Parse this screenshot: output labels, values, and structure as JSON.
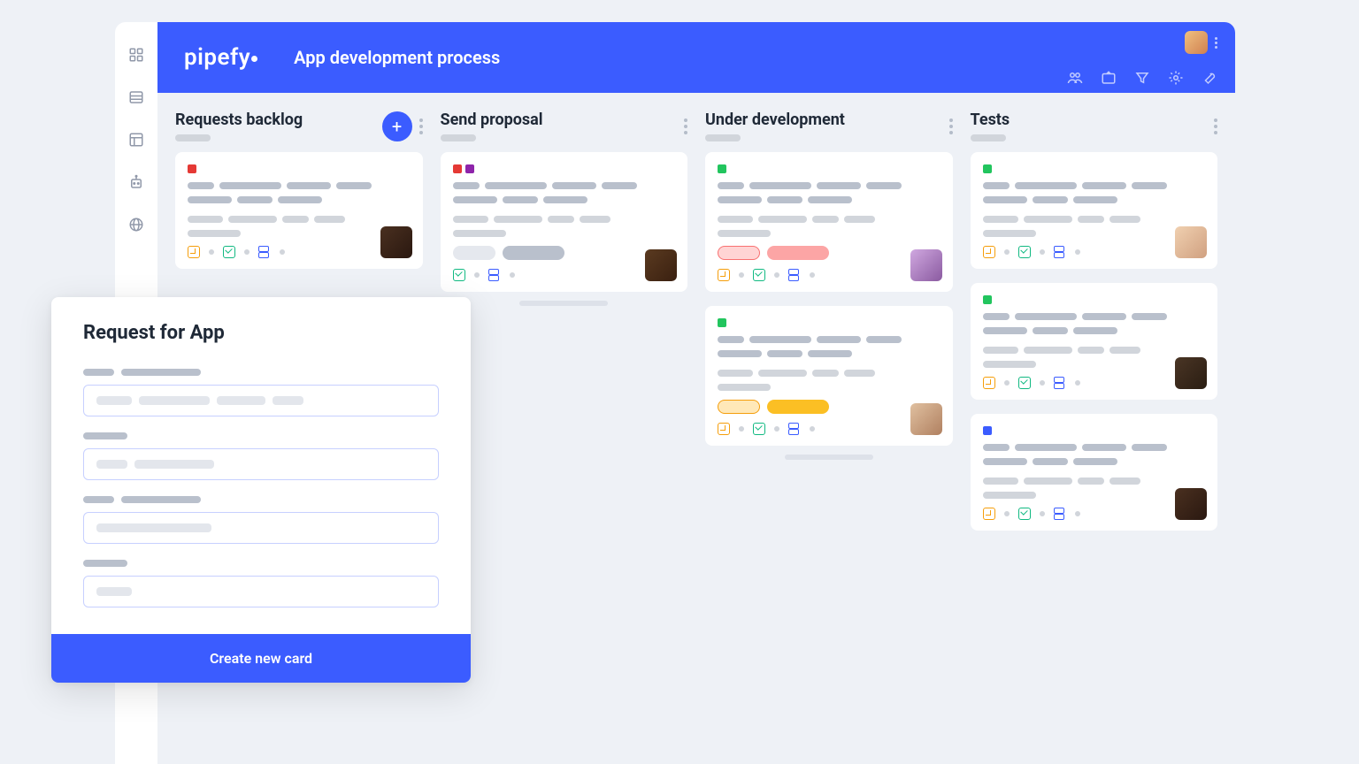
{
  "app": {
    "brand": "pipefy",
    "title": "App development process"
  },
  "rail": {
    "items": [
      "grid-icon",
      "list-icon",
      "layout-icon",
      "bot-icon",
      "globe-icon"
    ]
  },
  "header_tools": [
    "members-icon",
    "share-icon",
    "filter-icon",
    "settings-icon",
    "wrench-icon"
  ],
  "columns": [
    {
      "title": "Requests backlog",
      "has_add": true,
      "cards": [
        {
          "tags": [
            "#e53935"
          ],
          "avatar": "av1",
          "pill": null,
          "icons": [
            "orange",
            "green",
            "blue"
          ]
        }
      ]
    },
    {
      "title": "Send proposal",
      "has_add": false,
      "has_scroll_hint": true,
      "cards": [
        {
          "tags": [
            "#e53935",
            "#8e24aa"
          ],
          "avatar": "av2",
          "pill": {
            "bg": "#e5e8ee",
            "bar": "#b9c0cc"
          },
          "icons": [
            "green",
            "blue"
          ]
        }
      ]
    },
    {
      "title": "Under development",
      "has_add": false,
      "has_scroll_hint": true,
      "cards": [
        {
          "tags": [
            "#22c55e"
          ],
          "avatar": "av3",
          "pill": {
            "bg": "#ffd4d4",
            "bar": "#fca5a5",
            "outline": "#f87171"
          },
          "icons": [
            "orange",
            "green",
            "blue"
          ]
        },
        {
          "tags": [
            "#22c55e"
          ],
          "avatar": "av5",
          "pill": {
            "bg": "#ffe8b8",
            "bar": "#fbbf24",
            "outline": "#f59e0b"
          },
          "icons": [
            "orange",
            "green",
            "blue"
          ]
        }
      ]
    },
    {
      "title": "Tests",
      "has_add": false,
      "cards": [
        {
          "tags": [
            "#22c55e"
          ],
          "avatar": "av4",
          "pill": null,
          "icons": [
            "orange",
            "green",
            "blue"
          ]
        },
        {
          "tags": [
            "#22c55e"
          ],
          "avatar": "av6",
          "pill": null,
          "icons": [
            "orange",
            "green",
            "blue"
          ]
        },
        {
          "tags": [
            "#3b5cff"
          ],
          "avatar": "av1",
          "pill": null,
          "icons": [
            "orange",
            "green",
            "blue"
          ]
        }
      ]
    }
  ],
  "modal": {
    "title": "Request for App",
    "button": "Create new card",
    "fields": 4
  }
}
